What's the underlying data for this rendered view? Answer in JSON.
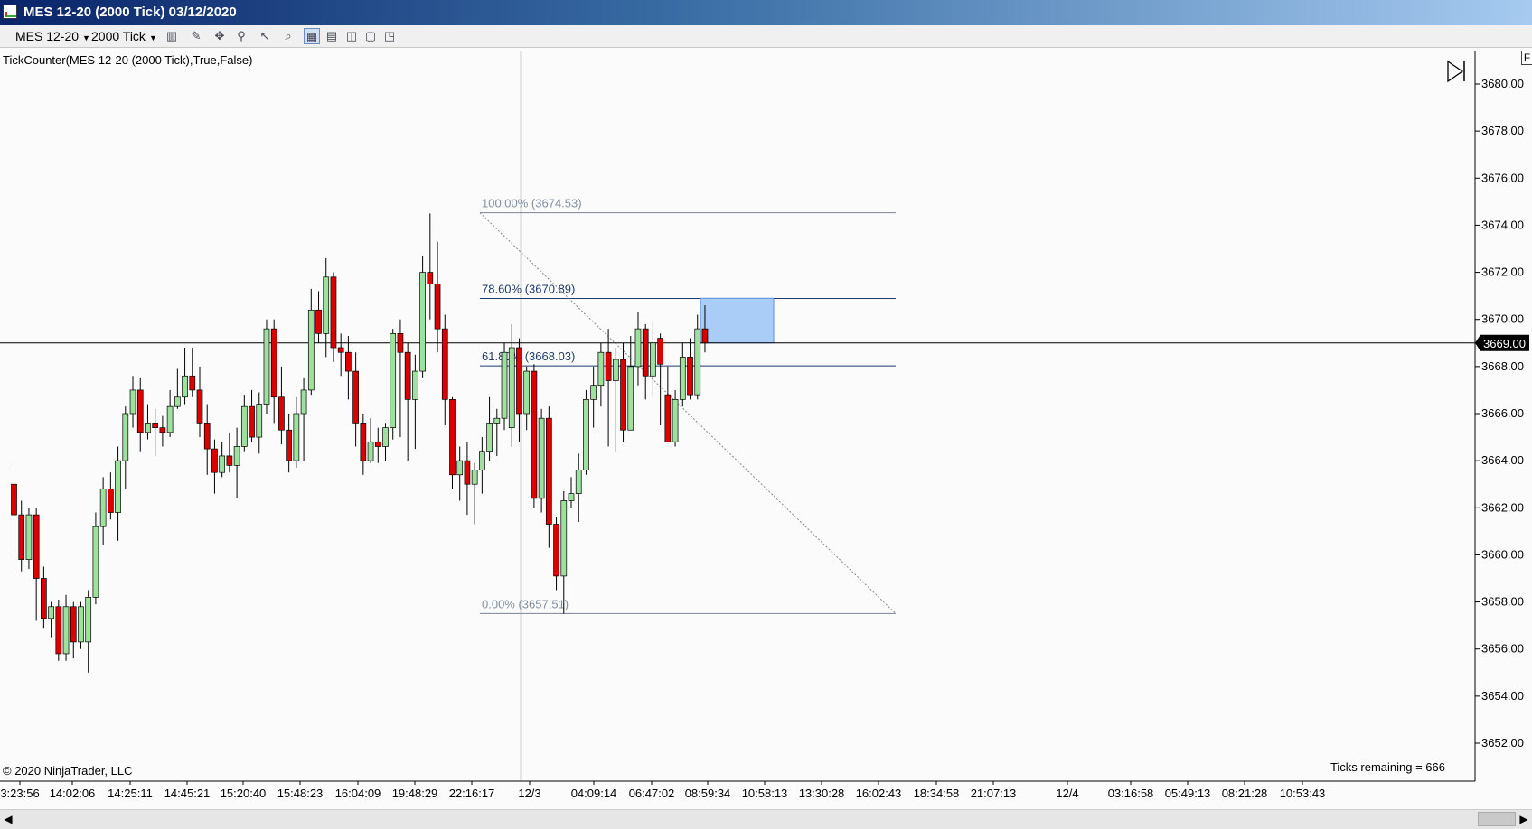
{
  "window": {
    "title": "MES 12-20 (2000 Tick)  03/12/2020"
  },
  "toolbar": {
    "instrument": "MES 12-20",
    "interval": "2000 Tick"
  },
  "indicator_label": "TickCounter(MES  12-20 (2000 Tick),True,False)",
  "copyright": "© 2020 NinjaTrader, LLC",
  "ticks_remaining": "Ticks remaining = 666",
  "corner_button": "F",
  "colors": {
    "up": "#9ee09e",
    "down": "#dd0000",
    "wick": "#000000",
    "fib_line": "#1f3a6e",
    "rectangle": "#a9cdf7",
    "price_marker": "#000000"
  },
  "chart_data": {
    "type": "candlestick",
    "y_axis": {
      "min": 3651,
      "max": 3681,
      "ticks": [
        "3652.00",
        "3654.00",
        "3656.00",
        "3658.00",
        "3660.00",
        "3662.00",
        "3664.00",
        "3666.00",
        "3668.00",
        "3670.00",
        "3672.00",
        "3674.00",
        "3676.00",
        "3678.00",
        "3680.00"
      ]
    },
    "x_tick_labels": [
      "3:23:56",
      "14:02:06",
      "14:25:11",
      "14:45:21",
      "15:20:40",
      "15:48:23",
      "16:04:09",
      "19:48:29",
      "22:16:17",
      "12/3",
      "04:09:14",
      "06:47:02",
      "08:59:34",
      "10:58:13",
      "13:30:28",
      "16:02:43",
      "18:34:58",
      "21:07:13",
      "12/4",
      "03:16:58",
      "05:49:13",
      "08:21:28",
      "10:53:43"
    ],
    "current_price": "3669.00",
    "fibonacci": [
      {
        "label": "100.00% (3674.53)",
        "price": 3674.53
      },
      {
        "label": "78.60% (3670.89)",
        "price": 3670.89
      },
      {
        "label": "61.80% (3668.03)",
        "price": 3668.03
      },
      {
        "label": "0.00% (3657.51)",
        "price": 3657.51
      }
    ],
    "candles": [
      [
        3663.0,
        3661.7,
        3663.9,
        3660.0
      ],
      [
        3661.7,
        3659.8,
        3662.3,
        3659.3
      ],
      [
        3659.8,
        3661.7,
        3662.0,
        3659.4
      ],
      [
        3661.7,
        3659.0,
        3662.0,
        3657.2
      ],
      [
        3659.0,
        3657.3,
        3659.5,
        3656.9
      ],
      [
        3657.3,
        3657.8,
        3658.0,
        3656.5
      ],
      [
        3657.8,
        3655.8,
        3658.1,
        3655.5
      ],
      [
        3655.8,
        3657.8,
        3658.3,
        3655.5
      ],
      [
        3657.8,
        3656.3,
        3658.0,
        3655.6
      ],
      [
        3656.3,
        3657.8,
        3658.0,
        3656.0
      ],
      [
        3656.3,
        3658.2,
        3658.5,
        3655.0
      ],
      [
        3658.2,
        3661.2,
        3661.8,
        3657.9
      ],
      [
        3661.2,
        3662.8,
        3663.3,
        3660.4
      ],
      [
        3662.8,
        3661.8,
        3663.5,
        3661.5
      ],
      [
        3661.8,
        3664.0,
        3664.6,
        3660.6
      ],
      [
        3664.0,
        3666.0,
        3666.3,
        3662.8
      ],
      [
        3666.0,
        3667.0,
        3667.6,
        3665.4
      ],
      [
        3667.0,
        3665.2,
        3667.5,
        3664.4
      ],
      [
        3665.2,
        3665.6,
        3666.4,
        3664.9
      ],
      [
        3665.6,
        3665.4,
        3666.2,
        3664.2
      ],
      [
        3665.4,
        3665.2,
        3665.9,
        3664.6
      ],
      [
        3665.2,
        3666.3,
        3667.0,
        3665.0
      ],
      [
        3666.3,
        3666.7,
        3667.9,
        3666.2
      ],
      [
        3666.7,
        3667.6,
        3668.8,
        3666.4
      ],
      [
        3667.6,
        3667.0,
        3668.8,
        3666.7
      ],
      [
        3667.0,
        3665.6,
        3668.0,
        3665.0
      ],
      [
        3665.6,
        3664.5,
        3666.4,
        3663.4
      ],
      [
        3664.5,
        3663.5,
        3664.9,
        3662.6
      ],
      [
        3663.5,
        3664.2,
        3664.8,
        3663.3
      ],
      [
        3664.2,
        3663.8,
        3665.2,
        3663.5
      ],
      [
        3663.8,
        3664.6,
        3665.4,
        3662.4
      ],
      [
        3664.6,
        3666.3,
        3666.8,
        3664.4
      ],
      [
        3666.3,
        3665.0,
        3667.0,
        3664.8
      ],
      [
        3665.0,
        3666.4,
        3666.9,
        3664.3
      ],
      [
        3666.4,
        3669.6,
        3670.0,
        3666.0
      ],
      [
        3669.6,
        3666.7,
        3670.0,
        3665.6
      ],
      [
        3666.7,
        3665.3,
        3668.0,
        3664.7
      ],
      [
        3665.3,
        3664.0,
        3666.0,
        3663.5
      ],
      [
        3664.0,
        3666.0,
        3666.7,
        3663.7
      ],
      [
        3666.0,
        3667.0,
        3667.5,
        3664.0
      ],
      [
        3667.0,
        3670.4,
        3671.3,
        3666.8
      ],
      [
        3670.4,
        3669.4,
        3671.2,
        3669.0
      ],
      [
        3669.4,
        3671.8,
        3672.6,
        3668.4
      ],
      [
        3671.8,
        3668.8,
        3672.0,
        3668.2
      ],
      [
        3668.8,
        3668.6,
        3669.4,
        3667.6
      ],
      [
        3668.6,
        3667.8,
        3669.3,
        3666.6
      ],
      [
        3667.8,
        3665.6,
        3668.6,
        3664.6
      ],
      [
        3665.6,
        3664.0,
        3666.0,
        3663.4
      ],
      [
        3664.0,
        3664.8,
        3665.8,
        3663.9
      ],
      [
        3664.8,
        3664.6,
        3665.4,
        3663.9
      ],
      [
        3664.6,
        3665.4,
        3665.6,
        3664.0
      ],
      [
        3665.4,
        3669.4,
        3669.6,
        3664.9
      ],
      [
        3669.4,
        3668.6,
        3670.0,
        3665.0
      ],
      [
        3668.6,
        3666.6,
        3669.0,
        3664.0
      ],
      [
        3666.6,
        3667.8,
        3668.5,
        3664.5
      ],
      [
        3667.8,
        3672.0,
        3672.7,
        3667.5
      ],
      [
        3672.0,
        3671.5,
        3674.5,
        3670.0
      ],
      [
        3671.5,
        3669.6,
        3673.3,
        3668.6
      ],
      [
        3669.6,
        3666.6,
        3670.2,
        3665.5
      ],
      [
        3666.6,
        3663.4,
        3666.7,
        3662.8
      ],
      [
        3663.4,
        3664.0,
        3664.6,
        3662.3
      ],
      [
        3664.0,
        3663.0,
        3664.8,
        3661.7
      ],
      [
        3663.0,
        3663.6,
        3663.9,
        3661.3
      ],
      [
        3663.6,
        3664.4,
        3665.0,
        3662.6
      ],
      [
        3664.4,
        3665.6,
        3666.7,
        3664.0
      ],
      [
        3665.6,
        3665.8,
        3666.2,
        3664.2
      ],
      [
        3665.8,
        3668.6,
        3669.0,
        3665.3
      ],
      [
        3665.4,
        3668.8,
        3669.8,
        3664.6
      ],
      [
        3668.8,
        3666.0,
        3669.2,
        3664.8
      ],
      [
        3666.0,
        3667.8,
        3668.0,
        3665.3
      ],
      [
        3667.8,
        3662.4,
        3668.1,
        3662.0
      ],
      [
        3662.4,
        3665.8,
        3666.2,
        3661.8
      ],
      [
        3665.8,
        3661.3,
        3666.3,
        3660.3
      ],
      [
        3661.3,
        3659.1,
        3661.6,
        3658.5
      ],
      [
        3659.1,
        3662.3,
        3662.7,
        3657.5
      ],
      [
        3662.3,
        3662.6,
        3663.3,
        3662.0
      ],
      [
        3662.6,
        3663.6,
        3664.3,
        3661.4
      ],
      [
        3663.6,
        3666.6,
        3667.0,
        3663.4
      ],
      [
        3666.6,
        3667.2,
        3668.0,
        3665.4
      ],
      [
        3667.2,
        3668.6,
        3669.0,
        3666.3
      ],
      [
        3668.6,
        3667.4,
        3669.6,
        3664.6
      ],
      [
        3667.4,
        3668.3,
        3668.8,
        3664.4
      ],
      [
        3668.3,
        3665.3,
        3669.0,
        3664.8
      ],
      [
        3665.3,
        3668.0,
        3669.3,
        3666.4
      ],
      [
        3668.0,
        3669.6,
        3670.3,
        3667.2
      ],
      [
        3669.6,
        3667.6,
        3669.8,
        3666.6
      ],
      [
        3667.6,
        3669.0,
        3669.9,
        3666.7
      ],
      [
        3669.2,
        3668.1,
        3669.4,
        3665.5
      ],
      [
        3666.8,
        3664.8,
        3668.0,
        3665.4
      ],
      [
        3664.8,
        3666.6,
        3667.0,
        3664.6
      ],
      [
        3666.6,
        3668.4,
        3669.0,
        3666.3
      ],
      [
        3668.4,
        3666.8,
        3669.2,
        3666.6
      ],
      [
        3666.8,
        3669.6,
        3670.2,
        3666.6
      ],
      [
        3669.6,
        3669.0,
        3670.6,
        3668.6
      ]
    ]
  }
}
